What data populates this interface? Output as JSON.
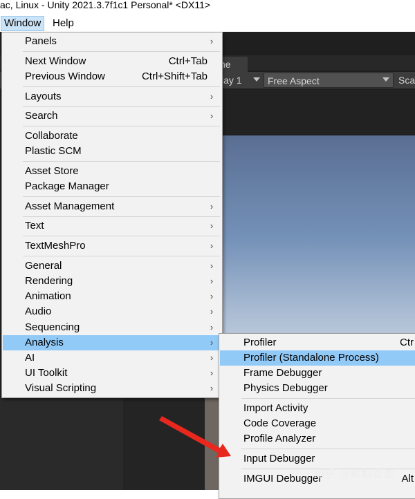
{
  "title_bar": {
    "text": "ac, Linux - Unity 2021.3.7f1c1 Personal* <DX11>"
  },
  "menubar": {
    "window": "Window",
    "help": "Help"
  },
  "editor": {
    "tab_fragment": "ne",
    "display_label": "lay 1",
    "aspect_label": "Free Aspect",
    "scale_label": "Sca"
  },
  "window_menu": {
    "items": [
      {
        "label": "Panels",
        "submenu": true
      },
      {
        "label": "Next Window",
        "shortcut": "Ctrl+Tab"
      },
      {
        "label": "Previous Window",
        "shortcut": "Ctrl+Shift+Tab"
      },
      {
        "label": "Layouts",
        "submenu": true
      },
      {
        "label": "Search",
        "submenu": true
      },
      {
        "label": "Collaborate"
      },
      {
        "label": "Plastic SCM"
      },
      {
        "label": "Asset Store"
      },
      {
        "label": "Package Manager"
      },
      {
        "label": "Asset Management",
        "submenu": true
      },
      {
        "label": "Text",
        "submenu": true
      },
      {
        "label": "TextMeshPro",
        "submenu": true
      },
      {
        "label": "General",
        "submenu": true
      },
      {
        "label": "Rendering",
        "submenu": true
      },
      {
        "label": "Animation",
        "submenu": true
      },
      {
        "label": "Audio",
        "submenu": true
      },
      {
        "label": "Sequencing",
        "submenu": true
      },
      {
        "label": "Analysis",
        "submenu": true,
        "highlighted": true
      },
      {
        "label": "AI",
        "submenu": true
      },
      {
        "label": "UI Toolkit",
        "submenu": true
      },
      {
        "label": "Visual Scripting",
        "submenu": true
      }
    ]
  },
  "analysis_submenu": {
    "items": [
      {
        "label": "Profiler",
        "shortcut": "Ctr"
      },
      {
        "label": "Profiler (Standalone Process)",
        "highlighted": true
      },
      {
        "label": "Frame Debugger"
      },
      {
        "label": "Physics Debugger"
      },
      {
        "label": "Import Activity"
      },
      {
        "label": "Code Coverage"
      },
      {
        "label": "Profile Analyzer"
      },
      {
        "label": "Input Debugger"
      },
      {
        "label": "IMGUI Debugger",
        "shortcut": "Alt"
      }
    ]
  },
  "watermark": "知乎 @紫荆青漱",
  "colors": {
    "highlight": "#91c9f7",
    "menu_bg": "#f2f2f2",
    "annotation_arrow": "#e8281f"
  },
  "icons": {
    "submenu_chevron": "chevron-right-icon",
    "arrow": "annotation-arrow-icon"
  }
}
